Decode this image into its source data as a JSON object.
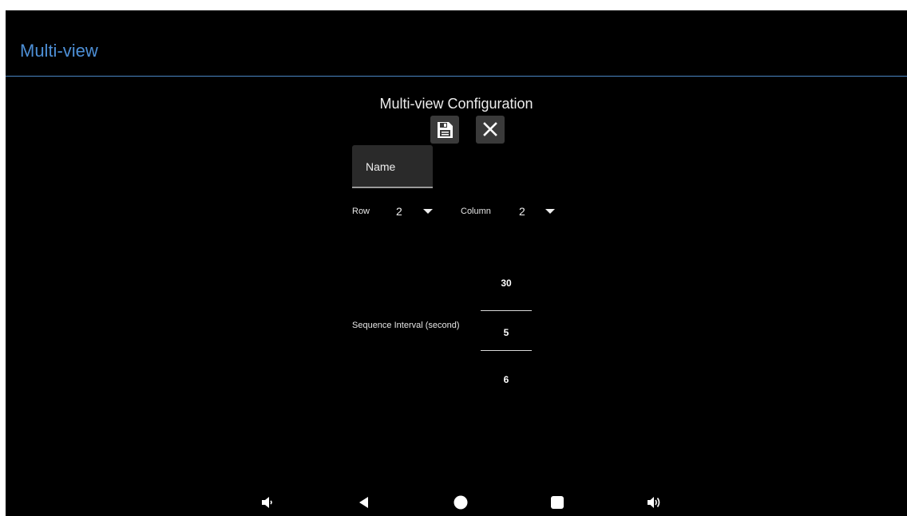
{
  "app_bar": {
    "title": "Multi-view"
  },
  "config": {
    "title": "Multi-view Configuration",
    "save_icon": "save-icon",
    "close_icon": "close-icon",
    "name_field": {
      "label": "Name",
      "value": ""
    },
    "row": {
      "label": "Row",
      "value": "2"
    },
    "column": {
      "label": "Column",
      "value": "2"
    },
    "sequence_interval": {
      "label": "Sequence Interval (second)",
      "prev": "30",
      "selected": "5",
      "next": "6"
    }
  },
  "nav_bar": {
    "items": [
      {
        "icon": "volume-down-icon"
      },
      {
        "icon": "back-icon"
      },
      {
        "icon": "home-icon"
      },
      {
        "icon": "recents-icon"
      },
      {
        "icon": "volume-up-icon"
      }
    ]
  },
  "colors": {
    "accent": "#4d8fd6",
    "background": "#000000",
    "button_bg": "#3a3a3a"
  }
}
